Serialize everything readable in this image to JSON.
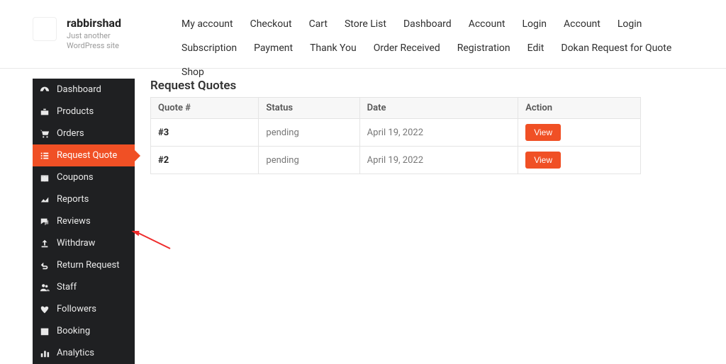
{
  "brand": {
    "site_title": "rabbirshad",
    "tagline": "Just another WordPress site"
  },
  "topnav": {
    "items": [
      "My account",
      "Checkout",
      "Cart",
      "Store List",
      "Dashboard",
      "Account",
      "Login",
      "Account",
      "Login",
      "Subscription",
      "Payment",
      "Thank You",
      "Order Received",
      "Registration",
      "Edit",
      "Dokan Request for Quote",
      "Shop"
    ]
  },
  "sidebar": {
    "items": [
      {
        "label": "Dashboard",
        "icon": "gauge-icon"
      },
      {
        "label": "Products",
        "icon": "briefcase-icon"
      },
      {
        "label": "Orders",
        "icon": "cart-icon"
      },
      {
        "label": "Request Quote",
        "icon": "list-icon",
        "active": true
      },
      {
        "label": "Coupons",
        "icon": "gift-icon"
      },
      {
        "label": "Reports",
        "icon": "chart-line-icon"
      },
      {
        "label": "Reviews",
        "icon": "comments-icon"
      },
      {
        "label": "Withdraw",
        "icon": "upload-icon"
      },
      {
        "label": "Return Request",
        "icon": "undo-icon"
      },
      {
        "label": "Staff",
        "icon": "users-icon"
      },
      {
        "label": "Followers",
        "icon": "heart-icon"
      },
      {
        "label": "Booking",
        "icon": "calendar-icon"
      },
      {
        "label": "Analytics",
        "icon": "bar-chart-icon"
      }
    ]
  },
  "page": {
    "title": "Request Quotes",
    "columns": [
      "Quote #",
      "Status",
      "Date",
      "Action"
    ],
    "rows": [
      {
        "id": "#3",
        "status": "pending",
        "date": "April 19, 2022",
        "action": "View"
      },
      {
        "id": "#2",
        "status": "pending",
        "date": "April 19, 2022",
        "action": "View"
      }
    ]
  },
  "colors": {
    "accent": "#f05025",
    "sidebar_bg": "#1f2022"
  }
}
